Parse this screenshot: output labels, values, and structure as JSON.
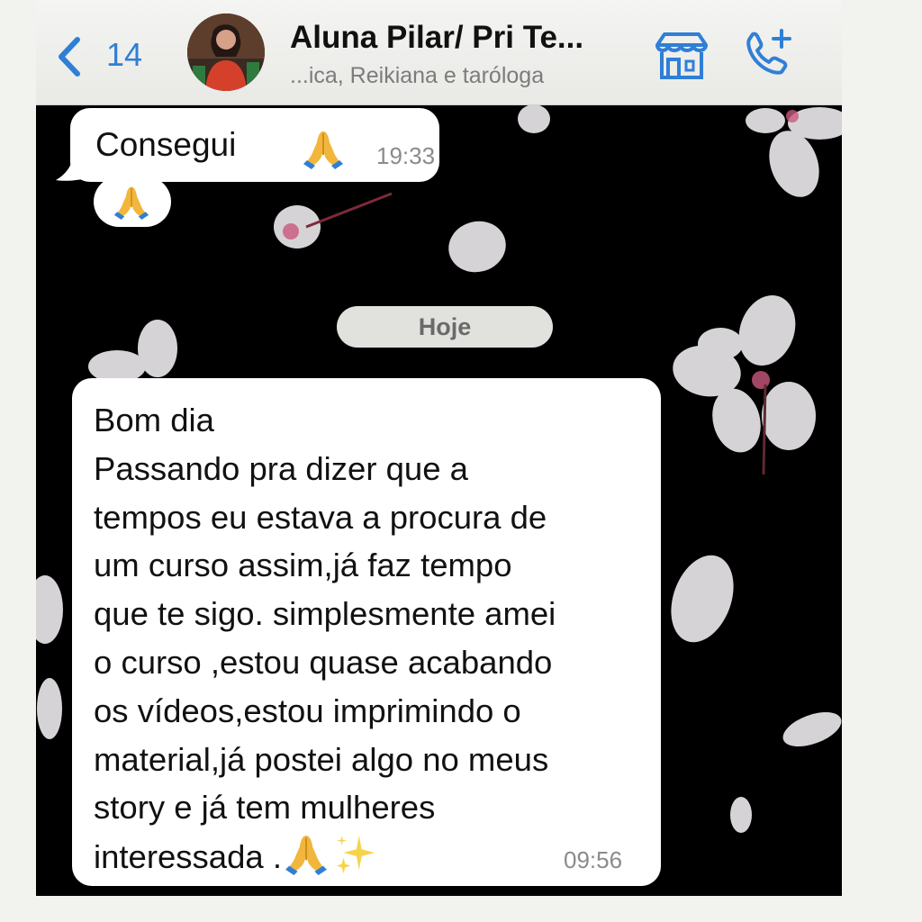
{
  "header": {
    "back_count": "14",
    "contact_name": "Aluna Pilar/ Pri Te...",
    "contact_subtitle": "...ica, Reikiana e taróloga"
  },
  "colors": {
    "accent": "#2f7fd6",
    "header_bg": "#efefec",
    "chat_bg": "#000000",
    "bubble_bg": "#ffffff",
    "date_pill_bg": "#e1e1de"
  },
  "icons": {
    "back": "chevron-left-icon",
    "business": "storefront-icon",
    "call": "phone-add-icon",
    "prayer": "folded-hands-emoji",
    "sparkles": "sparkles-emoji"
  },
  "messages": [
    {
      "text": "Consegui",
      "time": "19:33",
      "emoji": "folded-hands-emoji"
    },
    {
      "text": "",
      "emoji": "folded-hands-emoji"
    },
    {
      "lines": [
        "Bom dia",
        "Passando pra dizer que a",
        "tempos eu estava a procura de",
        "um curso assim,já faz tempo",
        "que te sigo. simplesmente amei",
        "o curso ,estou quase acabando",
        "os vídeos,estou imprimindo o",
        "material,já postei algo no meus",
        "story e já tem mulheres",
        "interessada ."
      ],
      "time": "09:56",
      "emojis": [
        "folded-hands-emoji",
        "sparkles-emoji"
      ]
    }
  ],
  "date_separator": "Hoje"
}
